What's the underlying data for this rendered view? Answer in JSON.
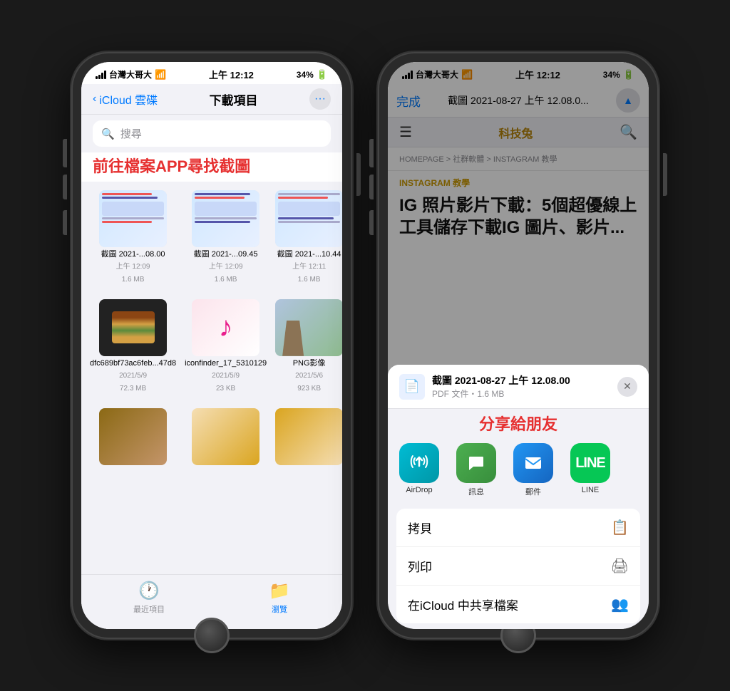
{
  "background_color": "#1a1a1a",
  "phone1": {
    "status_bar": {
      "carrier": "台灣大哥大",
      "wifi": "WiFi",
      "time": "上午 12:12",
      "battery": "34%"
    },
    "nav": {
      "back_label": "iCloud 雲碟",
      "title": "下載項目"
    },
    "search_placeholder": "搜尋",
    "annotation": "前往檔案APP尋找截圖",
    "files": [
      {
        "name": "截圖 2021-...08.00",
        "meta1": "上午 12:09",
        "meta2": "1.6 MB",
        "type": "screenshot"
      },
      {
        "name": "截圖 2021-...09.45",
        "meta1": "上午 12:09",
        "meta2": "1.6 MB",
        "type": "screenshot"
      },
      {
        "name": "截圖 2021-...10.44",
        "meta1": "上午 12:11",
        "meta2": "1.6 MB",
        "type": "screenshot"
      },
      {
        "name": "dfc689bf73ac6feb...47d8",
        "meta1": "2021/5/9",
        "meta2": "72.3 MB",
        "type": "burger"
      },
      {
        "name": "iconfinder_17_5310129",
        "meta1": "2021/5/9",
        "meta2": "23 KB",
        "type": "music"
      },
      {
        "name": "PNG影像",
        "meta1": "2021/5/6",
        "meta2": "923 KB",
        "type": "png"
      },
      {
        "name": "",
        "meta1": "",
        "meta2": "",
        "type": "photo1"
      },
      {
        "name": "",
        "meta1": "",
        "meta2": "",
        "type": "photo2"
      },
      {
        "name": "",
        "meta1": "",
        "meta2": "",
        "type": "photo3"
      }
    ],
    "tabs": [
      {
        "label": "最近項目",
        "icon": "🕐",
        "active": false
      },
      {
        "label": "瀏覽",
        "icon": "📁",
        "active": true
      }
    ]
  },
  "phone2": {
    "status_bar": {
      "carrier": "台灣大哥大",
      "wifi": "WiFi",
      "time": "上午 12:12",
      "battery": "34%"
    },
    "nav": {
      "done_label": "完成",
      "title": "截圖 2021-08-27 上午 12.08.0..."
    },
    "toolbar": {
      "menu_icon": "☰",
      "site_name": "科技兔",
      "search_icon": "🔍"
    },
    "breadcrumb": "HOMEPAGE > 社群軟體 > INSTAGRAM 教學",
    "article_category": "INSTAGRAM 教學",
    "article_title": "IG 照片影片下載：5個超優線上工具儲存下載IG 圖片、影片...",
    "share_sheet": {
      "file_name": "截圖 2021-08-27 上午 12.08.00",
      "file_meta": "PDF 文件・1.6 MB",
      "annotation": "分享給朋友",
      "apps": [
        {
          "label": "AirDrop",
          "type": "airdrop"
        },
        {
          "label": "訊息",
          "type": "messages"
        },
        {
          "label": "郵件",
          "type": "mail"
        },
        {
          "label": "LINE",
          "type": "line"
        }
      ],
      "actions": [
        {
          "label": "拷貝",
          "icon": "📋"
        },
        {
          "label": "列印",
          "icon": "🖨"
        },
        {
          "label": "在iCloud 中共享檔案",
          "icon": "👥"
        }
      ]
    }
  }
}
